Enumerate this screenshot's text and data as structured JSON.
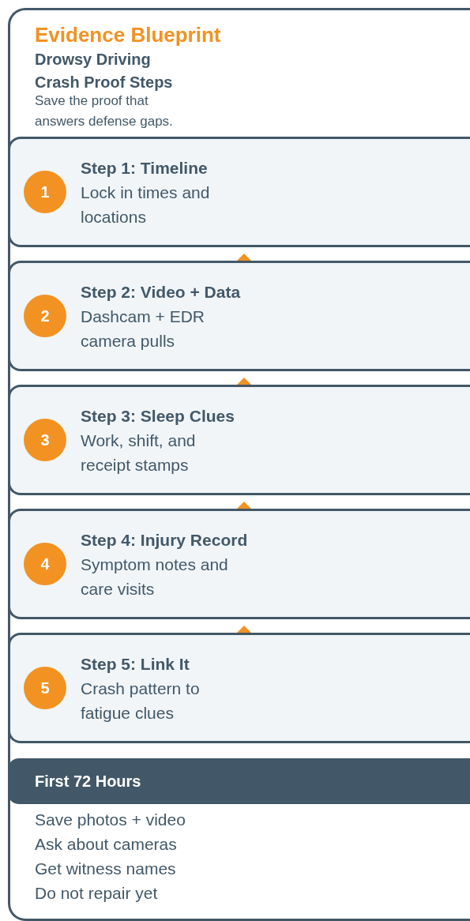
{
  "header": {
    "title": "Evidence Blueprint",
    "subtitle_lines": [
      "Drowsy Driving",
      "Crash Proof Steps"
    ],
    "description": "Save the proof that answers defense gaps."
  },
  "steps": [
    {
      "number": "1",
      "title": "Step 1: Timeline",
      "text": "Lock in times and locations"
    },
    {
      "number": "2",
      "title": "Step 2: Video + Data",
      "text": "Dashcam + EDR camera pulls"
    },
    {
      "number": "3",
      "title": "Step 3: Sleep Clues",
      "text": "Work, shift, and receipt stamps"
    },
    {
      "number": "4",
      "title": "Step 4: Injury Record",
      "text": "Symptom notes and care visits"
    },
    {
      "number": "5",
      "title": "Step 5: Link It",
      "text": "Crash pattern to fatigue clues"
    }
  ],
  "first_72_hours": {
    "title": "First 72 Hours",
    "items": [
      "Save photos + video",
      "Ask about cameras",
      "Get witness names",
      "Do not repair yet"
    ]
  }
}
